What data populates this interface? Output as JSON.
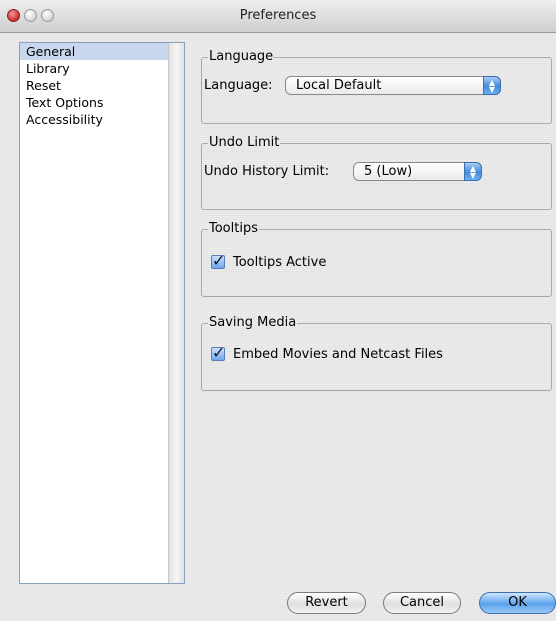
{
  "window": {
    "title": "Preferences"
  },
  "sidebar": {
    "items": [
      {
        "label": "General",
        "selected": true
      },
      {
        "label": "Library"
      },
      {
        "label": "Reset"
      },
      {
        "label": "Text Options"
      },
      {
        "label": "Accessibility"
      }
    ]
  },
  "language": {
    "group_title": "Language",
    "field_label": "Language:",
    "value": "Local Default"
  },
  "undo": {
    "group_title": "Undo Limit",
    "field_label": "Undo History Limit:",
    "value": "5 (Low)"
  },
  "tooltips": {
    "group_title": "Tooltips",
    "checkbox_label": "Tooltips Active",
    "checked": true
  },
  "saving": {
    "group_title": "Saving Media",
    "checkbox_label": "Embed Movies and Netcast Files",
    "checked": true
  },
  "buttons": {
    "revert": "Revert",
    "cancel": "Cancel",
    "ok": "OK"
  },
  "colors": {
    "selection": "#c9d7ee",
    "accent": "#3f8ae0"
  }
}
